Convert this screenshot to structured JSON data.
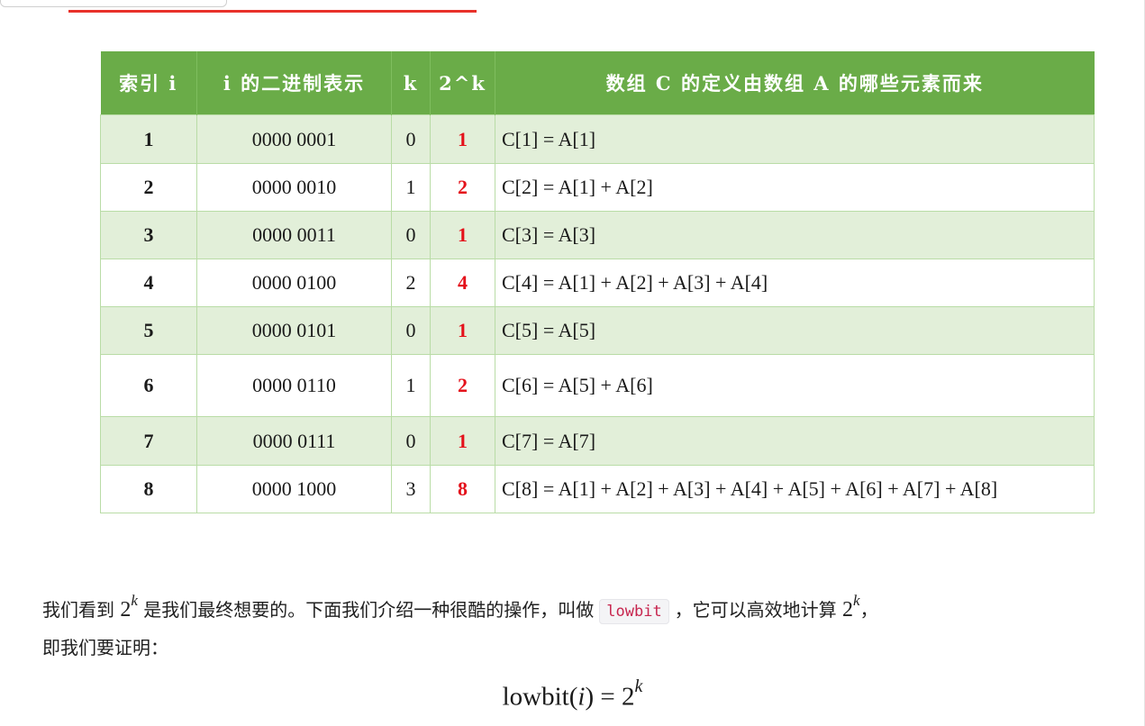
{
  "table": {
    "headers": [
      "索引 i",
      "i 的二进制表示",
      "k",
      "2^k",
      "数组 C 的定义由数组 A 的哪些元素而来"
    ],
    "rows": [
      {
        "i": "1",
        "binary": "0000 0001",
        "k": "0",
        "pow": "1",
        "def": "C[1] = A[1]"
      },
      {
        "i": "2",
        "binary": "0000 0010",
        "k": "1",
        "pow": "2",
        "def": "C[2] = A[1] + A[2]"
      },
      {
        "i": "3",
        "binary": "0000 0011",
        "k": "0",
        "pow": "1",
        "def": "C[3] = A[3]"
      },
      {
        "i": "4",
        "binary": "0000 0100",
        "k": "2",
        "pow": "4",
        "def": "C[4] = A[1] + A[2] + A[3] + A[4]"
      },
      {
        "i": "5",
        "binary": "0000 0101",
        "k": "0",
        "pow": "1",
        "def": "C[5] = A[5]"
      },
      {
        "i": "6",
        "binary": "0000 0110",
        "k": "1",
        "pow": "2",
        "def": "C[6] = A[5] + A[6]"
      },
      {
        "i": "7",
        "binary": "0000 0111",
        "k": "0",
        "pow": "1",
        "def": "C[7] = A[7]"
      },
      {
        "i": "8",
        "binary": "0000 1000",
        "k": "3",
        "pow": "8",
        "def": "C[8] = A[1] + A[2] + A[3] + A[4] + A[5] + A[6] + A[7] + A[8]"
      }
    ]
  },
  "paragraph": {
    "part1": "我们看到 ",
    "math_base": "2",
    "math_exp": "k",
    "part2": " 是我们最终想要的。下面我们介绍一种很酷的操作，叫做",
    "code": "lowbit",
    "part3": "，它可以高效地计算 ",
    "part4": "，",
    "line2": "即我们要证明："
  },
  "formula": {
    "fn": "lowbit",
    "open": "(",
    "arg": "i",
    "close": ")",
    "eq": " = ",
    "base": "2",
    "exp": "k"
  },
  "colors": {
    "header_bg": "#6aac48",
    "odd_row_bg": "#e2efd9",
    "pow_text": "#e4121b",
    "top_line": "#e8312a",
    "code_text": "#c7254e"
  }
}
